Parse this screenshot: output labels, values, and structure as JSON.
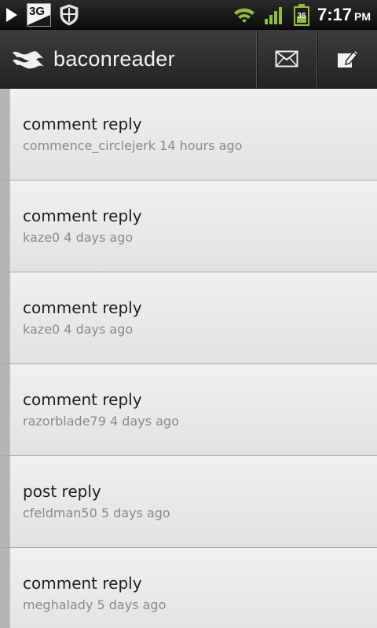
{
  "status_bar": {
    "network_badge": "3G",
    "battery_level": "36",
    "time": "7:17",
    "ampm": "PM",
    "icons": [
      "play-icon",
      "network-3g-icon",
      "shield-icon",
      "wifi-icon",
      "signal-icon",
      "battery-icon"
    ]
  },
  "action_bar": {
    "app_name": "baconreader",
    "icons": [
      "baconreader-logo-icon",
      "mail-icon",
      "compose-icon"
    ]
  },
  "messages": [
    {
      "title": "comment reply",
      "meta": "commence_circlejerk 14 hours ago"
    },
    {
      "title": "comment reply",
      "meta": "kaze0 4 days ago"
    },
    {
      "title": "comment reply",
      "meta": "kaze0 4 days ago"
    },
    {
      "title": "comment reply",
      "meta": "razorblade79 4 days ago"
    },
    {
      "title": "post reply",
      "meta": "cfeldman50 5 days ago"
    },
    {
      "title": "comment reply",
      "meta": "meghalady 5 days ago"
    }
  ],
  "colors": {
    "wifi": "#8fbf3a",
    "signal": "#8fbf3a",
    "battery": "#8fbf3a"
  }
}
